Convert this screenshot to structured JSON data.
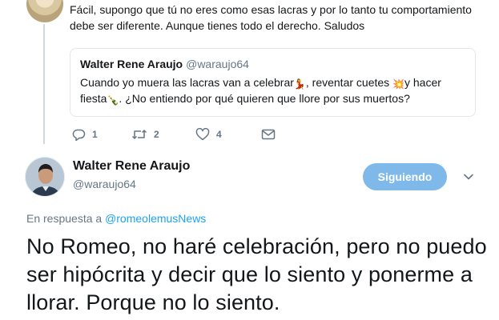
{
  "previous_tweet": {
    "text": "Fácil, supongo que tú no eres como esas lacras y por lo tanto tu comportamiento debe ser diferente. Aunque tienes todo el derecho. Saludos",
    "quoted": {
      "name": "Walter Rene Araujo",
      "handle": "@waraujo64",
      "text_part1": "Cuando yo muera las lacras van a celebrar",
      "emoji1": "💃",
      "text_part2": ", reventar cuetes",
      "emoji2": "💥",
      "text_part3": "y hacer fiesta",
      "emoji3": "🍾",
      "text_part4": ". ¿No entiendo por qué quieren que llore por sus muertos?"
    },
    "actions": {
      "reply_icon": "reply-icon",
      "reply_count": "1",
      "retweet_icon": "retweet-icon",
      "retweet_count": "2",
      "like_icon": "heart-icon",
      "like_count": "4",
      "dm_icon": "envelope-icon"
    }
  },
  "main_tweet": {
    "name": "Walter Rene Araujo",
    "handle": "@waraujo64",
    "follow_label": "Siguiendo",
    "menu_icon": "chevron-down-icon",
    "reply_prefix": "En respuesta a ",
    "reply_to": "@romeolemusNews",
    "text": "No Romeo, no haré celebración, pero no puedo ser hipócrita y decir que lo siento y ponerme a llorar. Porque no lo siento."
  },
  "colors": {
    "accent": "#1da1f2",
    "follow_button": "#7fb9ea",
    "secondary_text": "#657786",
    "border": "#e1e8ed"
  }
}
